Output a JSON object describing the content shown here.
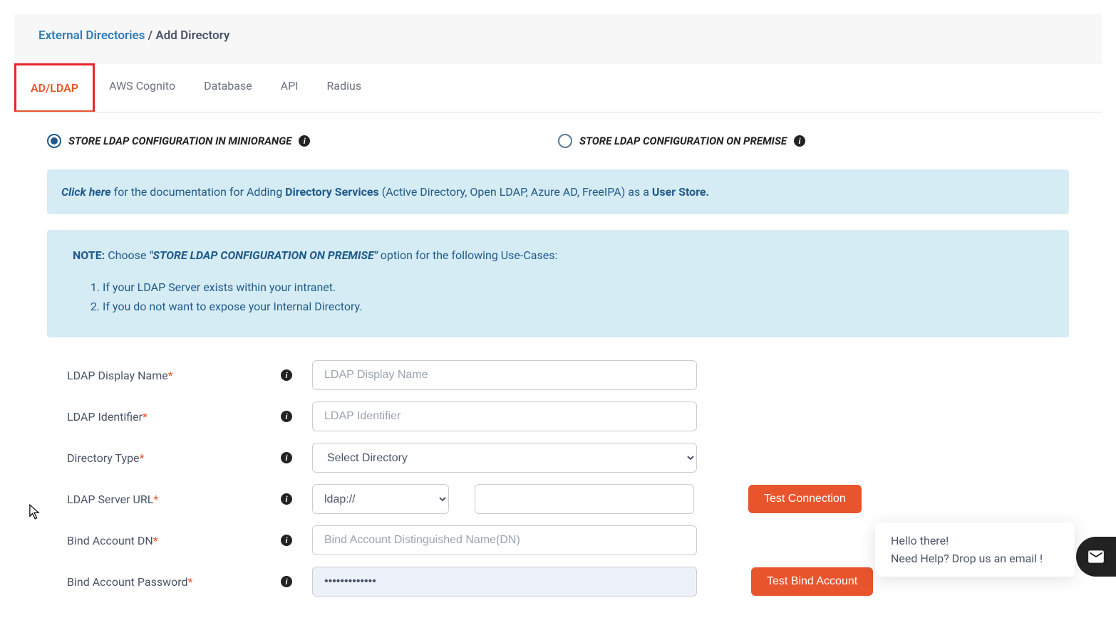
{
  "breadcrumb": {
    "parent": "External Directories",
    "sep": " / ",
    "current": "Add Directory"
  },
  "tabs": {
    "adldap": "AD/LDAP",
    "aws": "AWS Cognito",
    "database": "Database",
    "api": "API",
    "radius": "Radius"
  },
  "radios": {
    "miniorange": "STORE LDAP CONFIGURATION IN MINIORANGE",
    "onprem": "STORE LDAP CONFIGURATION ON PREMISE"
  },
  "doc_box": {
    "click": "Click here",
    "mid1": " for the documentation for Adding ",
    "strong1": "Directory Services",
    "mid2": " (Active Directory, Open LDAP, Azure AD, FreeIPA) as a ",
    "strong2": "User Store."
  },
  "note_box": {
    "title": "NOTE:",
    "lead1": "  Choose ",
    "emph": "\"STORE LDAP CONFIGURATION ON PREMISE\"",
    "lead2": " option for the following Use-Cases:",
    "item1": "If your LDAP Server exists within your intranet.",
    "item2": "If you do not want to expose your Internal Directory."
  },
  "form": {
    "display_name": {
      "label": "LDAP Display Name",
      "placeholder": "LDAP Display Name",
      "value": ""
    },
    "identifier": {
      "label": "LDAP Identifier",
      "placeholder": "LDAP Identifier",
      "value": ""
    },
    "dir_type": {
      "label": "Directory Type",
      "selected": "Select Directory"
    },
    "server_url": {
      "label": "LDAP Server URL",
      "protocol": "ldap://",
      "value": "",
      "test_btn": "Test Connection"
    },
    "bind_dn": {
      "label": "Bind Account DN",
      "placeholder": "Bind Account Distinguished Name(DN)",
      "value": ""
    },
    "bind_pw": {
      "label": "Bind Account Password",
      "value": "•••••••••••••",
      "test_btn": "Test Bind Account"
    }
  },
  "help": {
    "line1": "Hello there!",
    "line2": "Need Help? Drop us an email !"
  }
}
